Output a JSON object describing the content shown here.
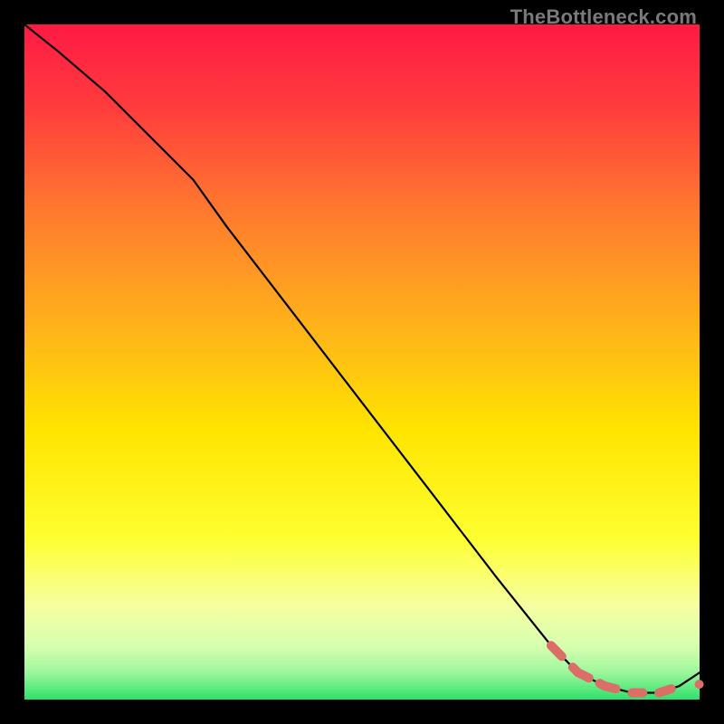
{
  "watermark": "TheBottleneck.com",
  "colors": {
    "page_bg": "#000000",
    "curve": "#000000",
    "accent": "#db6e67",
    "gradient_stops": [
      {
        "pct": 0,
        "color": "#ff1a44"
      },
      {
        "pct": 12,
        "color": "#ff3b3d"
      },
      {
        "pct": 28,
        "color": "#ff7b2e"
      },
      {
        "pct": 45,
        "color": "#ffb31a"
      },
      {
        "pct": 60,
        "color": "#ffe400"
      },
      {
        "pct": 76,
        "color": "#feff2f"
      },
      {
        "pct": 86,
        "color": "#f6ffa0"
      },
      {
        "pct": 92,
        "color": "#d8ffb0"
      },
      {
        "pct": 96,
        "color": "#9cf79c"
      },
      {
        "pct": 100,
        "color": "#2fe06a"
      }
    ]
  },
  "chart_data": {
    "type": "line",
    "title": "",
    "xlabel": "",
    "ylabel": "",
    "xlim": [
      0,
      100
    ],
    "ylim": [
      0,
      100
    ],
    "grid": false,
    "series": [
      {
        "name": "curve",
        "x": [
          0,
          5,
          12,
          20,
          25,
          30,
          40,
          50,
          60,
          70,
          78,
          82,
          86,
          90,
          94,
          97,
          100
        ],
        "y": [
          100,
          96,
          90,
          82,
          77,
          70,
          57,
          44,
          31,
          18,
          8,
          4,
          2,
          1,
          1,
          2,
          4
        ]
      }
    ],
    "highlight": {
      "name": "dashed-segment",
      "description": "thick salmon dashed overlay on lower-right tail",
      "x_range": [
        78,
        97
      ],
      "y_range": [
        1,
        8
      ]
    }
  }
}
